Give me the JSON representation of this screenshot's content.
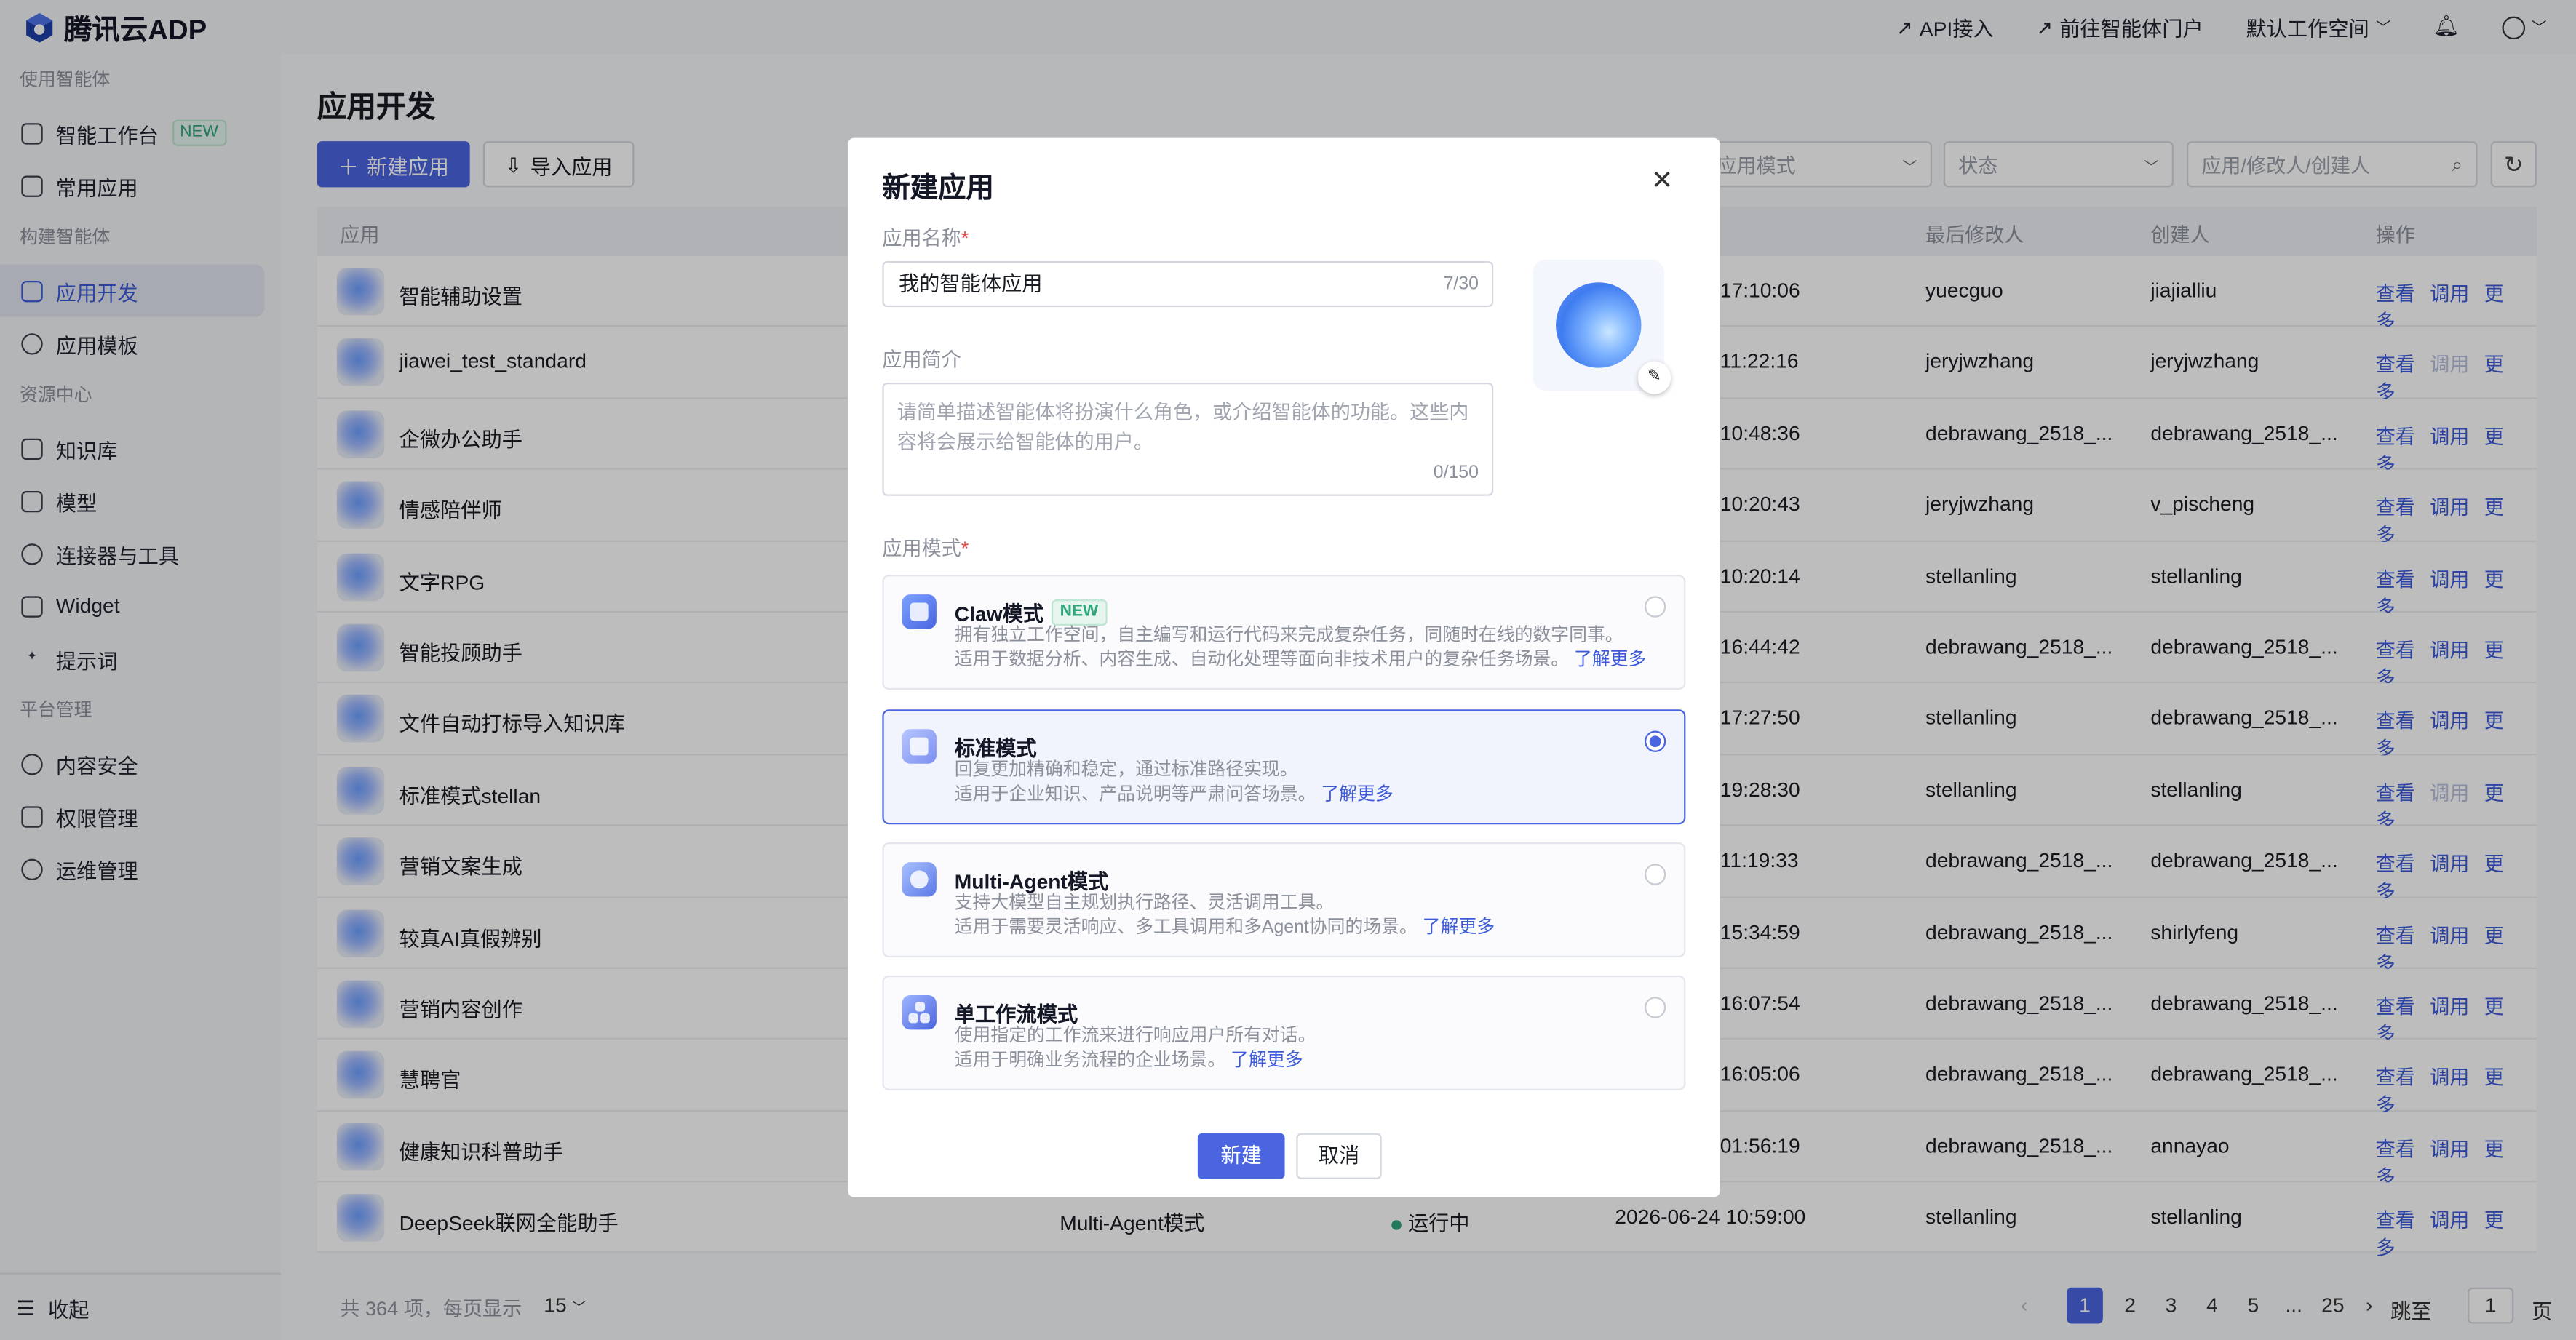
{
  "app": {
    "logo_text": "腾讯云ADP"
  },
  "topbar": {
    "api": "API接入",
    "portal": "前往智能体门户",
    "workspace": "默认工作空间"
  },
  "sidebar": {
    "groups": [
      "使用智能体",
      "构建智能体",
      "资源中心",
      "平台管理"
    ],
    "items": [
      {
        "label": "智能工作台",
        "badge": "NEW"
      },
      {
        "label": "常用应用"
      },
      {
        "label": "应用开发"
      },
      {
        "label": "应用模板"
      },
      {
        "label": "知识库"
      },
      {
        "label": "模型"
      },
      {
        "label": "连接器与工具"
      },
      {
        "label": "Widget"
      },
      {
        "label": "提示词"
      },
      {
        "label": "内容安全"
      },
      {
        "label": "权限管理"
      },
      {
        "label": "运维管理"
      }
    ],
    "collapse": "收起"
  },
  "main": {
    "title": "应用开发",
    "new_btn": "新建应用",
    "import_btn": "导入应用",
    "filter_mode": "应用模式",
    "filter_status": "状态",
    "search_placeholder": "应用/修改人/创建人",
    "headers": {
      "app": "应用",
      "modifier": "最后修改人",
      "creator": "创建人",
      "ops": "操作"
    },
    "rows": [
      {
        "name": "智能辅助设置",
        "time": "17:10:06",
        "modifier": "yuecguo",
        "creator": "jiajialliu",
        "debug_disabled": false
      },
      {
        "name": "jiawei_test_standard",
        "time": "11:22:16",
        "modifier": "jeryjwzhang",
        "creator": "jeryjwzhang",
        "debug_disabled": true
      },
      {
        "name": "企微办公助手",
        "time": "10:48:36",
        "modifier": "debrawang_2518_...",
        "creator": "debrawang_2518_...",
        "debug_disabled": false
      },
      {
        "name": "情感陪伴师",
        "time": "10:20:43",
        "modifier": "jeryjwzhang",
        "creator": "v_pischeng",
        "debug_disabled": false
      },
      {
        "name": "文字RPG",
        "time": "10:20:14",
        "modifier": "stellanling",
        "creator": "stellanling",
        "debug_disabled": false
      },
      {
        "name": "智能投顾助手",
        "time": "16:44:42",
        "modifier": "debrawang_2518_...",
        "creator": "debrawang_2518_...",
        "debug_disabled": false
      },
      {
        "name": "文件自动打标导入知识库",
        "time": "17:27:50",
        "modifier": "stellanling",
        "creator": "debrawang_2518_...",
        "debug_disabled": false
      },
      {
        "name": "标准模式stellan",
        "time": "19:28:30",
        "modifier": "stellanling",
        "creator": "stellanling",
        "debug_disabled": true
      },
      {
        "name": "营销文案生成",
        "time": "11:19:33",
        "modifier": "debrawang_2518_...",
        "creator": "debrawang_2518_...",
        "debug_disabled": false
      },
      {
        "name": "较真AI真假辨别",
        "time": "15:34:59",
        "modifier": "debrawang_2518_...",
        "creator": "shirlyfeng",
        "debug_disabled": false
      },
      {
        "name": "营销内容创作",
        "time": "16:07:54",
        "modifier": "debrawang_2518_...",
        "creator": "debrawang_2518_...",
        "debug_disabled": false
      },
      {
        "name": "慧聘官",
        "time": "16:05:06",
        "modifier": "debrawang_2518_...",
        "creator": "debrawang_2518_...",
        "debug_disabled": false
      },
      {
        "name": "健康知识科普助手",
        "time": "01:56:19",
        "modifier": "debrawang_2518_...",
        "creator": "annayao",
        "debug_disabled": false
      },
      {
        "name": "DeepSeek联网全能助手",
        "mode": "Multi-Agent模式",
        "status": "运行中",
        "time": "2026-06-24 10:59:00",
        "modifier": "stellanling",
        "creator": "stellanling",
        "debug_disabled": false
      }
    ],
    "ops": {
      "view": "查看",
      "debug": "调用",
      "more": "更多"
    },
    "pager": {
      "total": "共 364 项，每页显示",
      "size": "15",
      "pages": [
        "1",
        "2",
        "3",
        "4",
        "5",
        "...",
        "25"
      ],
      "jump": "跳至",
      "jump_val": "1",
      "page_unit": "页"
    }
  },
  "modal": {
    "title": "新建应用",
    "name_label": "应用名称",
    "name_value": "我的智能体应用",
    "name_count": "7/30",
    "desc_label": "应用简介",
    "desc_placeholder": "请简单描述智能体将扮演什么角色，或介绍智能体的功能。这些内容将会展示给智能体的用户。",
    "desc_count": "0/150",
    "mode_label": "应用模式",
    "modes": [
      {
        "name": "Claw模式",
        "badge": "NEW",
        "line1": "拥有独立工作空间，自主编写和运行代码来完成复杂任务，同随时在线的数字同事。",
        "line2": "适用于数据分析、内容生成、自动化处理等面向非技术用户的复杂任务场景。",
        "more": "了解更多",
        "selected": false
      },
      {
        "name": "标准模式",
        "line1": "回复更加精确和稳定，通过标准路径实现。",
        "line2": "适用于企业知识、产品说明等严肃问答场景。",
        "more": "了解更多",
        "selected": true
      },
      {
        "name": "Multi-Agent模式",
        "line1": "支持大模型自主规划执行路径、灵活调用工具。",
        "line2": "适用于需要灵活响应、多工具调用和多Agent协同的场景。",
        "more": "了解更多",
        "selected": false
      },
      {
        "name": "单工作流模式",
        "line1": "使用指定的工作流来进行响应用户所有对话。",
        "line2": "适用于明确业务流程的企业场景。",
        "more": "了解更多",
        "selected": false
      }
    ],
    "ok": "新建",
    "cancel": "取消"
  }
}
